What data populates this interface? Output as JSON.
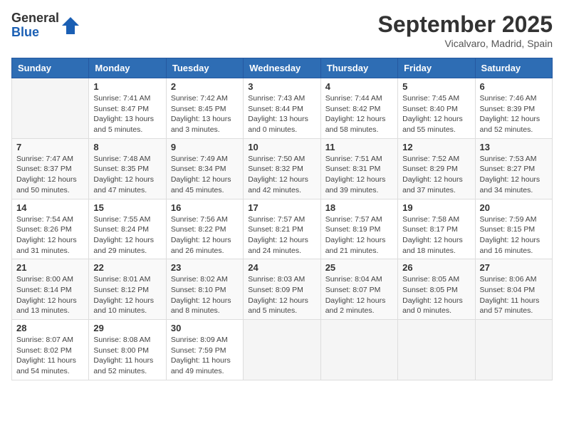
{
  "header": {
    "logo_general": "General",
    "logo_blue": "Blue",
    "month_title": "September 2025",
    "location": "Vicalvaro, Madrid, Spain"
  },
  "days_of_week": [
    "Sunday",
    "Monday",
    "Tuesday",
    "Wednesday",
    "Thursday",
    "Friday",
    "Saturday"
  ],
  "weeks": [
    [
      {
        "day": "",
        "sunrise": "",
        "sunset": "",
        "daylight": ""
      },
      {
        "day": "1",
        "sunrise": "Sunrise: 7:41 AM",
        "sunset": "Sunset: 8:47 PM",
        "daylight": "Daylight: 13 hours and 5 minutes."
      },
      {
        "day": "2",
        "sunrise": "Sunrise: 7:42 AM",
        "sunset": "Sunset: 8:45 PM",
        "daylight": "Daylight: 13 hours and 3 minutes."
      },
      {
        "day": "3",
        "sunrise": "Sunrise: 7:43 AM",
        "sunset": "Sunset: 8:44 PM",
        "daylight": "Daylight: 13 hours and 0 minutes."
      },
      {
        "day": "4",
        "sunrise": "Sunrise: 7:44 AM",
        "sunset": "Sunset: 8:42 PM",
        "daylight": "Daylight: 12 hours and 58 minutes."
      },
      {
        "day": "5",
        "sunrise": "Sunrise: 7:45 AM",
        "sunset": "Sunset: 8:40 PM",
        "daylight": "Daylight: 12 hours and 55 minutes."
      },
      {
        "day": "6",
        "sunrise": "Sunrise: 7:46 AM",
        "sunset": "Sunset: 8:39 PM",
        "daylight": "Daylight: 12 hours and 52 minutes."
      }
    ],
    [
      {
        "day": "7",
        "sunrise": "Sunrise: 7:47 AM",
        "sunset": "Sunset: 8:37 PM",
        "daylight": "Daylight: 12 hours and 50 minutes."
      },
      {
        "day": "8",
        "sunrise": "Sunrise: 7:48 AM",
        "sunset": "Sunset: 8:35 PM",
        "daylight": "Daylight: 12 hours and 47 minutes."
      },
      {
        "day": "9",
        "sunrise": "Sunrise: 7:49 AM",
        "sunset": "Sunset: 8:34 PM",
        "daylight": "Daylight: 12 hours and 45 minutes."
      },
      {
        "day": "10",
        "sunrise": "Sunrise: 7:50 AM",
        "sunset": "Sunset: 8:32 PM",
        "daylight": "Daylight: 12 hours and 42 minutes."
      },
      {
        "day": "11",
        "sunrise": "Sunrise: 7:51 AM",
        "sunset": "Sunset: 8:31 PM",
        "daylight": "Daylight: 12 hours and 39 minutes."
      },
      {
        "day": "12",
        "sunrise": "Sunrise: 7:52 AM",
        "sunset": "Sunset: 8:29 PM",
        "daylight": "Daylight: 12 hours and 37 minutes."
      },
      {
        "day": "13",
        "sunrise": "Sunrise: 7:53 AM",
        "sunset": "Sunset: 8:27 PM",
        "daylight": "Daylight: 12 hours and 34 minutes."
      }
    ],
    [
      {
        "day": "14",
        "sunrise": "Sunrise: 7:54 AM",
        "sunset": "Sunset: 8:26 PM",
        "daylight": "Daylight: 12 hours and 31 minutes."
      },
      {
        "day": "15",
        "sunrise": "Sunrise: 7:55 AM",
        "sunset": "Sunset: 8:24 PM",
        "daylight": "Daylight: 12 hours and 29 minutes."
      },
      {
        "day": "16",
        "sunrise": "Sunrise: 7:56 AM",
        "sunset": "Sunset: 8:22 PM",
        "daylight": "Daylight: 12 hours and 26 minutes."
      },
      {
        "day": "17",
        "sunrise": "Sunrise: 7:57 AM",
        "sunset": "Sunset: 8:21 PM",
        "daylight": "Daylight: 12 hours and 24 minutes."
      },
      {
        "day": "18",
        "sunrise": "Sunrise: 7:57 AM",
        "sunset": "Sunset: 8:19 PM",
        "daylight": "Daylight: 12 hours and 21 minutes."
      },
      {
        "day": "19",
        "sunrise": "Sunrise: 7:58 AM",
        "sunset": "Sunset: 8:17 PM",
        "daylight": "Daylight: 12 hours and 18 minutes."
      },
      {
        "day": "20",
        "sunrise": "Sunrise: 7:59 AM",
        "sunset": "Sunset: 8:15 PM",
        "daylight": "Daylight: 12 hours and 16 minutes."
      }
    ],
    [
      {
        "day": "21",
        "sunrise": "Sunrise: 8:00 AM",
        "sunset": "Sunset: 8:14 PM",
        "daylight": "Daylight: 12 hours and 13 minutes."
      },
      {
        "day": "22",
        "sunrise": "Sunrise: 8:01 AM",
        "sunset": "Sunset: 8:12 PM",
        "daylight": "Daylight: 12 hours and 10 minutes."
      },
      {
        "day": "23",
        "sunrise": "Sunrise: 8:02 AM",
        "sunset": "Sunset: 8:10 PM",
        "daylight": "Daylight: 12 hours and 8 minutes."
      },
      {
        "day": "24",
        "sunrise": "Sunrise: 8:03 AM",
        "sunset": "Sunset: 8:09 PM",
        "daylight": "Daylight: 12 hours and 5 minutes."
      },
      {
        "day": "25",
        "sunrise": "Sunrise: 8:04 AM",
        "sunset": "Sunset: 8:07 PM",
        "daylight": "Daylight: 12 hours and 2 minutes."
      },
      {
        "day": "26",
        "sunrise": "Sunrise: 8:05 AM",
        "sunset": "Sunset: 8:05 PM",
        "daylight": "Daylight: 12 hours and 0 minutes."
      },
      {
        "day": "27",
        "sunrise": "Sunrise: 8:06 AM",
        "sunset": "Sunset: 8:04 PM",
        "daylight": "Daylight: 11 hours and 57 minutes."
      }
    ],
    [
      {
        "day": "28",
        "sunrise": "Sunrise: 8:07 AM",
        "sunset": "Sunset: 8:02 PM",
        "daylight": "Daylight: 11 hours and 54 minutes."
      },
      {
        "day": "29",
        "sunrise": "Sunrise: 8:08 AM",
        "sunset": "Sunset: 8:00 PM",
        "daylight": "Daylight: 11 hours and 52 minutes."
      },
      {
        "day": "30",
        "sunrise": "Sunrise: 8:09 AM",
        "sunset": "Sunset: 7:59 PM",
        "daylight": "Daylight: 11 hours and 49 minutes."
      },
      {
        "day": "",
        "sunrise": "",
        "sunset": "",
        "daylight": ""
      },
      {
        "day": "",
        "sunrise": "",
        "sunset": "",
        "daylight": ""
      },
      {
        "day": "",
        "sunrise": "",
        "sunset": "",
        "daylight": ""
      },
      {
        "day": "",
        "sunrise": "",
        "sunset": "",
        "daylight": ""
      }
    ]
  ]
}
